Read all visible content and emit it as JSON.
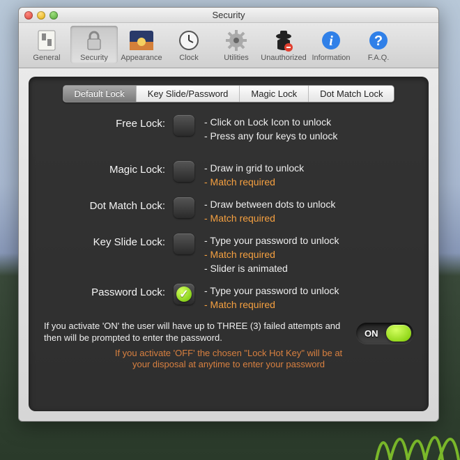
{
  "window": {
    "title": "Security"
  },
  "toolbar": [
    {
      "label": "General"
    },
    {
      "label": "Security"
    },
    {
      "label": "Appearance"
    },
    {
      "label": "Clock"
    },
    {
      "label": "Utilities"
    },
    {
      "label": "Unauthorized"
    },
    {
      "label": "Information"
    },
    {
      "label": "F.A.Q."
    }
  ],
  "tabs": [
    "Default Lock",
    "Key Slide/Password",
    "Magic Lock",
    "Dot Match Lock"
  ],
  "locks": {
    "free": {
      "name": "Free Lock:",
      "d1": "- Click on Lock Icon to unlock",
      "d2": "- Press any four keys to unlock"
    },
    "magic": {
      "name": "Magic Lock:",
      "d1": "- Draw in grid to unlock",
      "d2": "- Match required"
    },
    "dot": {
      "name": "Dot Match Lock:",
      "d1": "- Draw between dots to unlock",
      "d2": "- Match required"
    },
    "key": {
      "name": "Key Slide Lock:",
      "d1": "- Type your password to unlock",
      "d2": "- Match required",
      "d3": "- Slider is animated"
    },
    "pwd": {
      "name": "Password Lock:",
      "d1": "- Type your password to unlock",
      "d2": "- Match required"
    }
  },
  "footer": {
    "on_text": "If you activate 'ON' the user will have up to THREE (3) failed attempts and then will be prompted to enter the password.",
    "toggle_label": "ON",
    "off_text1": "If you activate 'OFF' the chosen \"Lock Hot Key\" will be at",
    "off_text2": "your disposal at anytime to enter your password"
  }
}
